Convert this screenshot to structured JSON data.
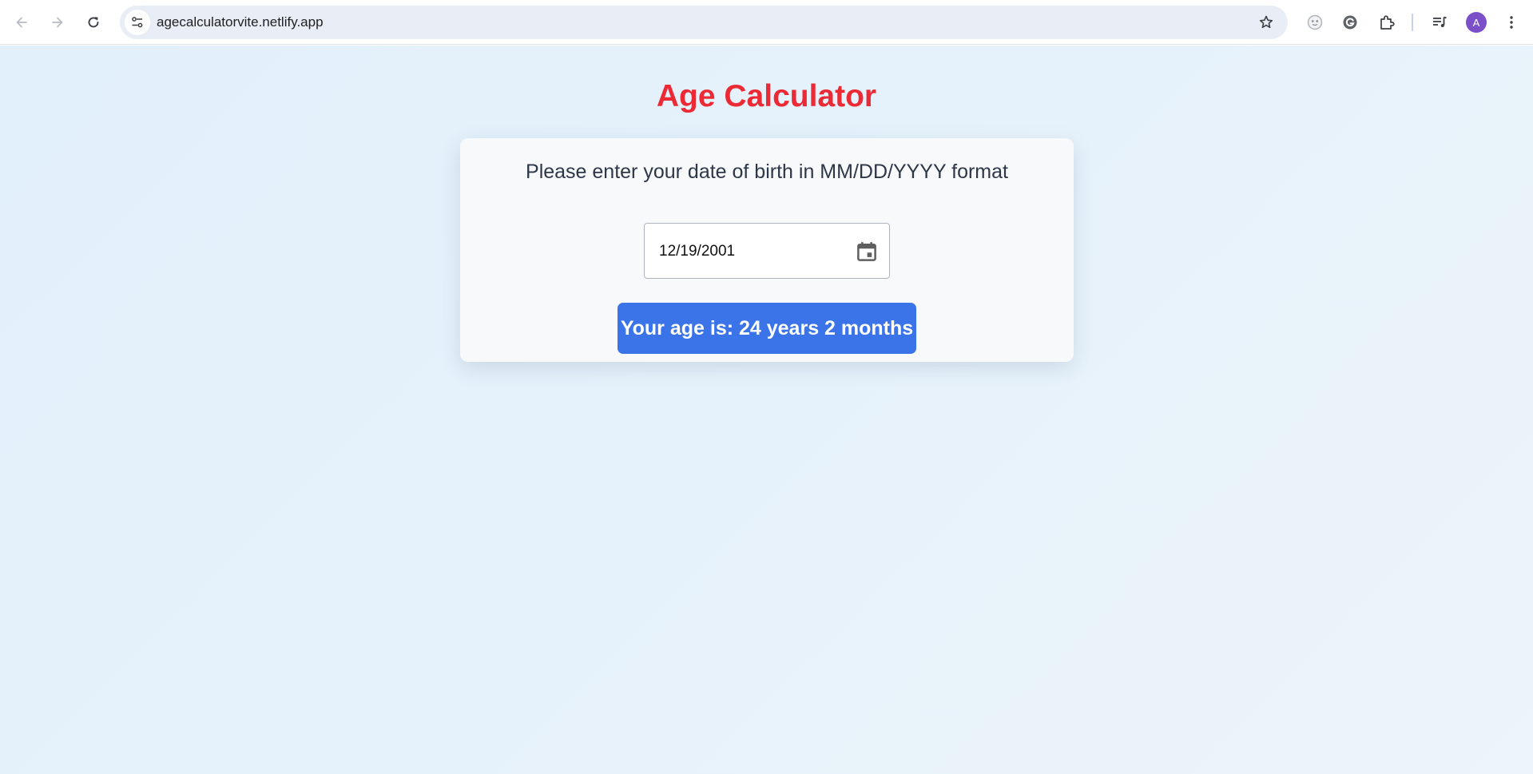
{
  "browser": {
    "url": "agecalculatorvite.netlify.app",
    "profile_initial": "A",
    "icons": {
      "back": "arrow-left-icon",
      "forward": "arrow-right-icon",
      "reload": "reload-icon",
      "site_info": "tune-icon",
      "bookmark": "star-icon",
      "extension_1": "ghost-extension-icon",
      "extension_2": "grammarly-icon",
      "extensions": "puzzle-icon",
      "media": "playlist-icon",
      "menu": "kebab-menu-icon"
    }
  },
  "app": {
    "title": "Age Calculator",
    "prompt": "Please enter your date of birth in MM/DD/YYYY format",
    "date_value": "12/19/2001",
    "result": "Your age is: 24 years 2 months"
  },
  "colors": {
    "title": "#ec2a35",
    "result_bg": "#3b73e8",
    "card_bg": "#f7f9fb",
    "page_bg": "#e4f1fb",
    "avatar_bg": "#7a4fc7"
  }
}
